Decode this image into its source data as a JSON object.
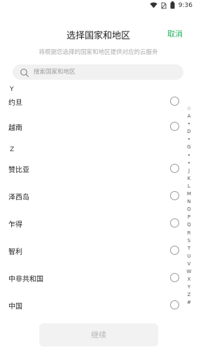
{
  "status_bar": {
    "time": "9:36"
  },
  "header": {
    "title": "选择国家和地区",
    "cancel_label": "取消"
  },
  "subtitle": "将根据您选择的国家和地区提供对应的云服务",
  "search": {
    "placeholder": "搜索国家和地区"
  },
  "sections": [
    {
      "letter": "Y",
      "items": [
        "约旦",
        "越南"
      ]
    },
    {
      "letter": "Z",
      "items": [
        "赞比亚",
        "泽西岛",
        "乍得",
        "智利",
        "中非共和国",
        "中国"
      ]
    }
  ],
  "index_letters": [
    "☆",
    "A",
    "•",
    "D",
    "•",
    "G",
    "•",
    "•",
    "J",
    "K",
    "L",
    "M",
    "N",
    "O",
    "P",
    "Q",
    "R",
    "S",
    "T",
    "U",
    "V",
    "W",
    "X",
    "Y",
    "Z",
    "#"
  ],
  "continue_label": "继续",
  "colors": {
    "accent": "#20b25c"
  }
}
